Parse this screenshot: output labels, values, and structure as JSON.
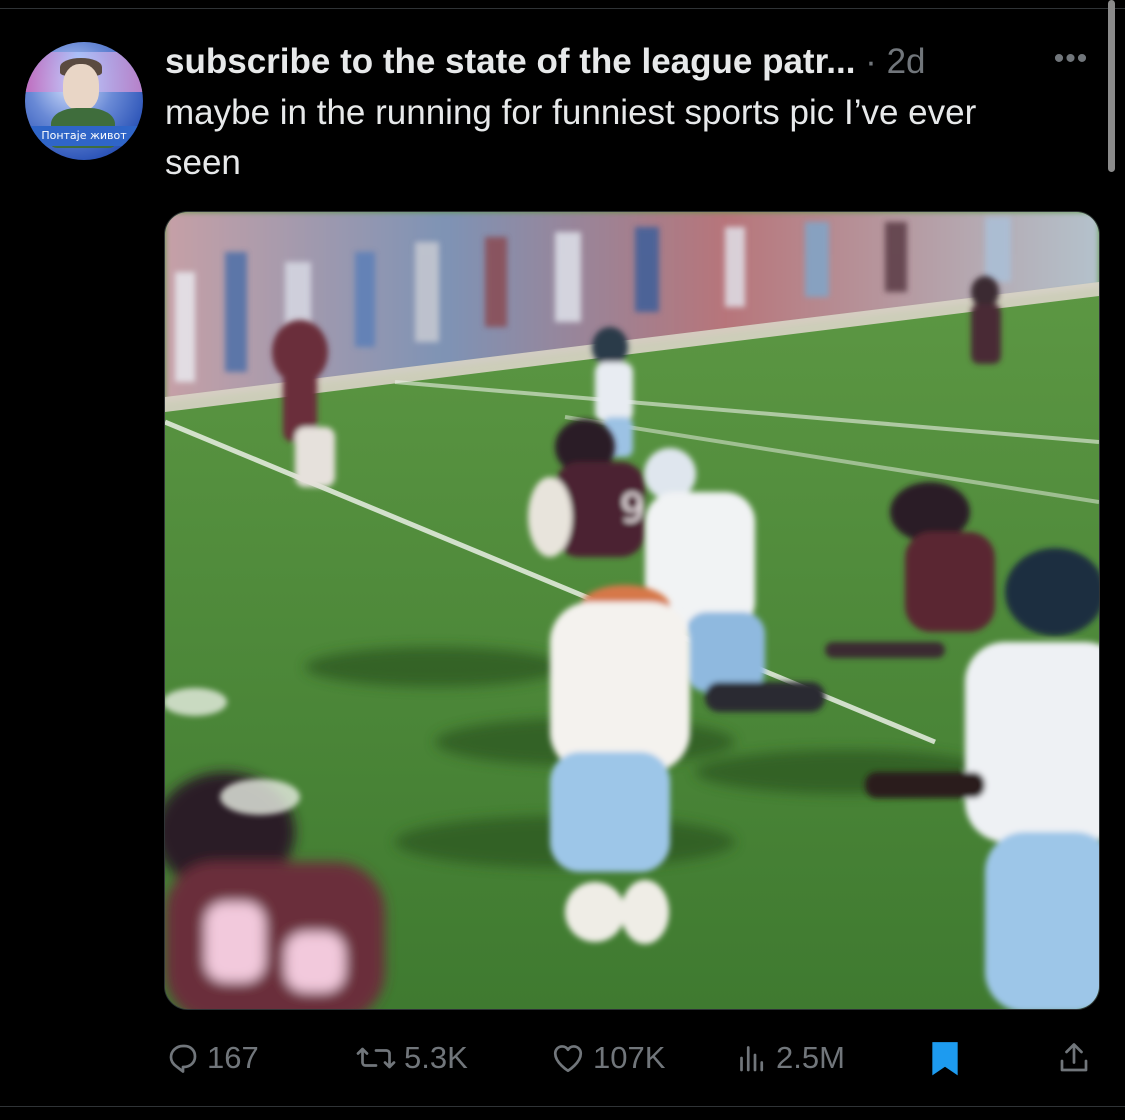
{
  "tweet": {
    "display_name": "subscribe to the state of the league patr...",
    "separator": "·",
    "time": "2d",
    "more_label": "•••",
    "text": "maybe in the running for funniest sports pic I’ve ever seen",
    "avatar_banner_text": "Понтаје живот"
  },
  "media": {
    "description_icon": "football-photo"
  },
  "actions": {
    "replies": "167",
    "reposts": "5.3K",
    "likes": "107K",
    "views": "2.5M"
  },
  "icons": {
    "reply": "reply-icon",
    "repost": "repost-icon",
    "like": "heart-icon",
    "views": "views-icon",
    "bookmark": "bookmark-icon",
    "share": "share-icon"
  },
  "colors": {
    "background": "#000000",
    "text": "#e7e9ea",
    "muted": "#71767b",
    "bookmark": "#1d9bf0"
  }
}
